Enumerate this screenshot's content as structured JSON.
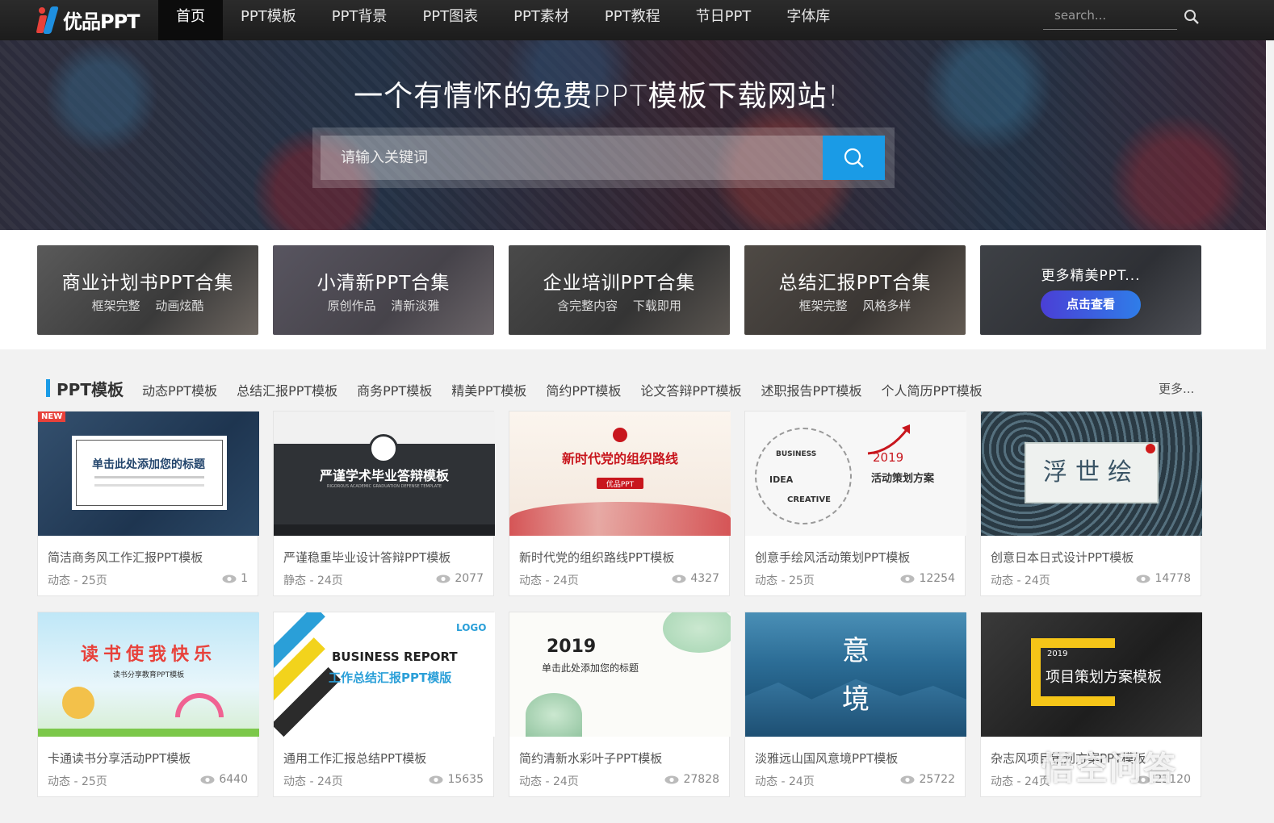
{
  "nav": {
    "logo_text": "优品PPT",
    "items": [
      {
        "label": "首页",
        "active": true
      },
      {
        "label": "PPT模板"
      },
      {
        "label": "PPT背景"
      },
      {
        "label": "PPT图表"
      },
      {
        "label": "PPT素材"
      },
      {
        "label": "PPT教程"
      },
      {
        "label": "节日PPT"
      },
      {
        "label": "字体库"
      }
    ],
    "search_placeholder": "search..."
  },
  "hero": {
    "title": "一个有情怀的免费PPT模板下载网站!",
    "search_placeholder": "请输入关键词"
  },
  "collections": [
    {
      "title": "商业计划书PPT合集",
      "subtitle": "框架完整 动画炫酷"
    },
    {
      "title": "小清新PPT合集",
      "subtitle": "原创作品 清新淡雅"
    },
    {
      "title": "企业培训PPT合集",
      "subtitle": "含完整内容 下载即用"
    },
    {
      "title": "总结汇报PPT合集",
      "subtitle": "框架完整 风格多样"
    },
    {
      "title": "更多精美PPT...",
      "button": "点击查看"
    }
  ],
  "section": {
    "title": "PPT模板",
    "links": [
      "动态PPT模板",
      "总结汇报PPT模板",
      "商务PPT模板",
      "精美PPT模板",
      "简约PPT模板",
      "论文答辩PPT模板",
      "述职报告PPT模板",
      "个人简历PPT模板"
    ],
    "more": "更多..."
  },
  "cards": [
    {
      "title": "简洁商务风工作汇报PPT模板",
      "meta": "动态 - 25页",
      "views": "1",
      "badge": "NEW",
      "thumb_text": "单击此处添加您的标题"
    },
    {
      "title": "严谨稳重毕业设计答辩PPT模板",
      "meta": "静态 - 24页",
      "views": "2077",
      "thumb_text": "严谨学术毕业答辩模板",
      "thumb_sub": "RIGOROUS ACADEMIC GRADUATION DEFENSE TEMPLATE"
    },
    {
      "title": "新时代党的组织路线PPT模板",
      "meta": "动态 - 24页",
      "views": "4327",
      "thumb_text": "新时代党的组织路线",
      "thumb_sub": "优品PPT"
    },
    {
      "title": "创意手绘风活动策划PPT模板",
      "meta": "动态 - 25页",
      "views": "12254",
      "thumb_text": "活动策划方案",
      "thumb_sub": "2019"
    },
    {
      "title": "创意日本日式设计PPT模板",
      "meta": "动态 - 24页",
      "views": "14778",
      "thumb_text": "浮世绘"
    },
    {
      "title": "卡通读书分享活动PPT模板",
      "meta": "动态 - 25页",
      "views": "6440",
      "thumb_text": "读书使我快乐",
      "thumb_sub": "读书分享教育PPT模板"
    },
    {
      "title": "通用工作汇报总结PPT模板",
      "meta": "动态 - 24页",
      "views": "15635",
      "thumb_text": "BUSINESS REPORT",
      "thumb_sub": "工作总结汇报PPT模版"
    },
    {
      "title": "简约清新水彩叶子PPT模板",
      "meta": "动态 - 24页",
      "views": "27828",
      "thumb_text": "2019",
      "thumb_sub": "单击此处添加您的标题"
    },
    {
      "title": "淡雅远山国风意境PPT模板",
      "meta": "动态 - 24页",
      "views": "25722",
      "thumb_text": "意",
      "thumb_sub": "境"
    },
    {
      "title": "杂志风项目策划方案PPT模板",
      "meta": "动态 - 24页",
      "views": "22120",
      "thumb_text": "项目策划方案模板",
      "thumb_sub": "2019"
    }
  ],
  "watermark": "悟空问答",
  "colors": {
    "accent": "#1a9be6",
    "nav_bg": "#1c1c1c",
    "badge": "#e8413a"
  }
}
